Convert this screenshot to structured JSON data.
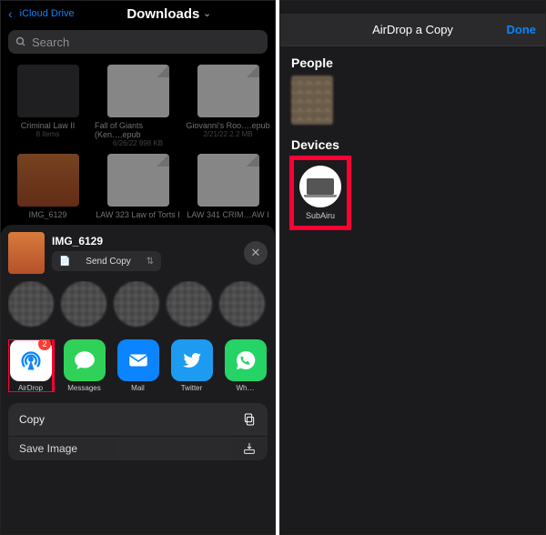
{
  "left": {
    "nav": {
      "back": "iCloud Drive",
      "title": "Downloads"
    },
    "search": {
      "placeholder": "Search"
    },
    "files": [
      {
        "name": "Criminal Law II",
        "meta": "8 items"
      },
      {
        "name": "Fall of Giants (Ken….epub",
        "meta": "6/26/22\n898 KB"
      },
      {
        "name": "Giovanni's Roo….epub",
        "meta": "2/21/22\n2.2 MB"
      },
      {
        "name": "IMG_6129",
        "meta": ""
      },
      {
        "name": "LAW 323 Law of Torts I",
        "meta": ""
      },
      {
        "name": "LAW 341 CRIM…AW I",
        "meta": ""
      }
    ],
    "sheet": {
      "file": "IMG_6129",
      "mode": "Send Copy",
      "apps": [
        {
          "key": "airdrop",
          "label": "AirDrop",
          "badge": "2"
        },
        {
          "key": "messages",
          "label": "Messages"
        },
        {
          "key": "mail",
          "label": "Mail"
        },
        {
          "key": "twitter",
          "label": "Twitter"
        },
        {
          "key": "whatsapp",
          "label": "Wh…"
        }
      ],
      "actions": [
        {
          "label": "Copy",
          "icon": "copy"
        },
        {
          "label": "Save Image",
          "icon": "download"
        }
      ]
    }
  },
  "right": {
    "title": "AirDrop a Copy",
    "done": "Done",
    "people_label": "People",
    "devices_label": "Devices",
    "device": {
      "name": "SubAiru"
    }
  }
}
